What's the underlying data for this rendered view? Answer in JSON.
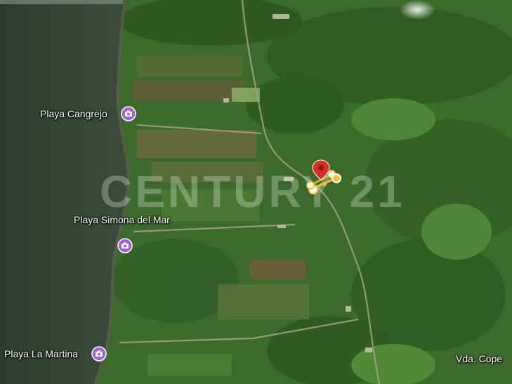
{
  "map": {
    "type": "satellite",
    "places": [
      {
        "name": "Playa Cangrejo",
        "icon": "camera-poi-icon"
      },
      {
        "name": "Playa Simona del Mar",
        "icon": "camera-poi-icon"
      },
      {
        "name": "Playa La Martina",
        "icon": "camera-poi-icon"
      },
      {
        "name": "Vda. Cope",
        "icon": "none"
      }
    ],
    "watermark": "CENTURY 21",
    "pin": {
      "icon": "location-pin-icon",
      "color": "#d93025"
    },
    "colors": {
      "water": "#2f4233",
      "land": "#3f6a2e",
      "poi": "#a65fd6",
      "path_marker": "#f2c230"
    }
  }
}
